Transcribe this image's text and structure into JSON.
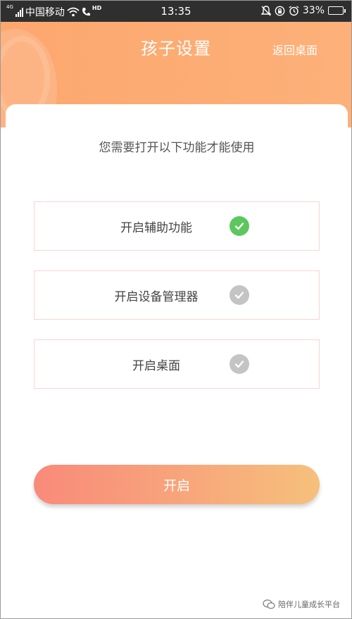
{
  "status_bar": {
    "network": "4G",
    "carrier": "中国移动",
    "hd": "HD",
    "time": "13:35",
    "battery": "33%",
    "battery_level": 0.33
  },
  "header": {
    "title": "孩子设置",
    "back_label": "返回桌面"
  },
  "main": {
    "instruction": "您需要打开以下功能才能使用",
    "permissions": [
      {
        "label": "开启辅助功能",
        "enabled": true,
        "check_color": "#5cc75c"
      },
      {
        "label": "开启设备管理器",
        "enabled": false,
        "check_color": "#c4c4c4"
      },
      {
        "label": "开启桌面",
        "enabled": false,
        "check_color": "#c4c4c4"
      }
    ],
    "start_label": "开启"
  },
  "watermark": {
    "text": "陪伴儿童成长平台"
  }
}
